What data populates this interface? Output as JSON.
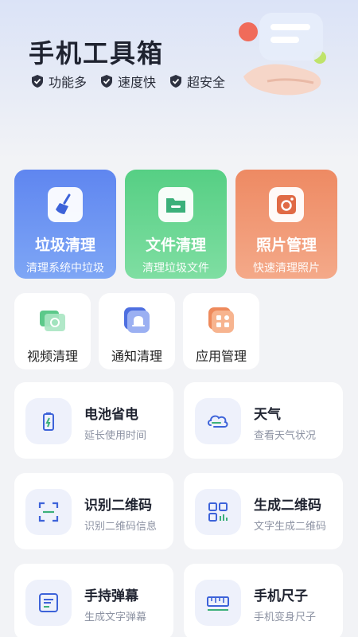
{
  "header": {
    "title": "手机工具箱",
    "features": [
      "功能多",
      "速度快",
      "超安全"
    ]
  },
  "big_cards": [
    {
      "title": "垃圾清理",
      "subtitle": "清理系统中垃圾",
      "icon": "broom-icon"
    },
    {
      "title": "文件清理",
      "subtitle": "清理垃圾文件",
      "icon": "folder-icon"
    },
    {
      "title": "照片管理",
      "subtitle": "快速清理照片",
      "icon": "camera-icon"
    }
  ],
  "mid_cards": [
    {
      "title": "视频清理",
      "icon": "video-icon"
    },
    {
      "title": "通知清理",
      "icon": "bell-icon"
    },
    {
      "title": "应用管理",
      "icon": "apps-icon"
    }
  ],
  "tiles": [
    {
      "title": "电池省电",
      "subtitle": "延长使用时间",
      "icon": "battery-icon"
    },
    {
      "title": "天气",
      "subtitle": "查看天气状况",
      "icon": "cloud-icon"
    },
    {
      "title": "识别二维码",
      "subtitle": "识别二维码信息",
      "icon": "scan-icon"
    },
    {
      "title": "生成二维码",
      "subtitle": "文字生成二维码",
      "icon": "qrcode-icon"
    },
    {
      "title": "手持弹幕",
      "subtitle": "生成文字弹幕",
      "icon": "text-icon"
    },
    {
      "title": "手机尺子",
      "subtitle": "手机变身尺子",
      "icon": "ruler-icon"
    }
  ],
  "colors": {
    "blue": "#5f86f0",
    "green": "#56cf84",
    "orange": "#ee8a63",
    "icon_blue": "#3d63d9",
    "icon_green": "#3bb07a"
  }
}
